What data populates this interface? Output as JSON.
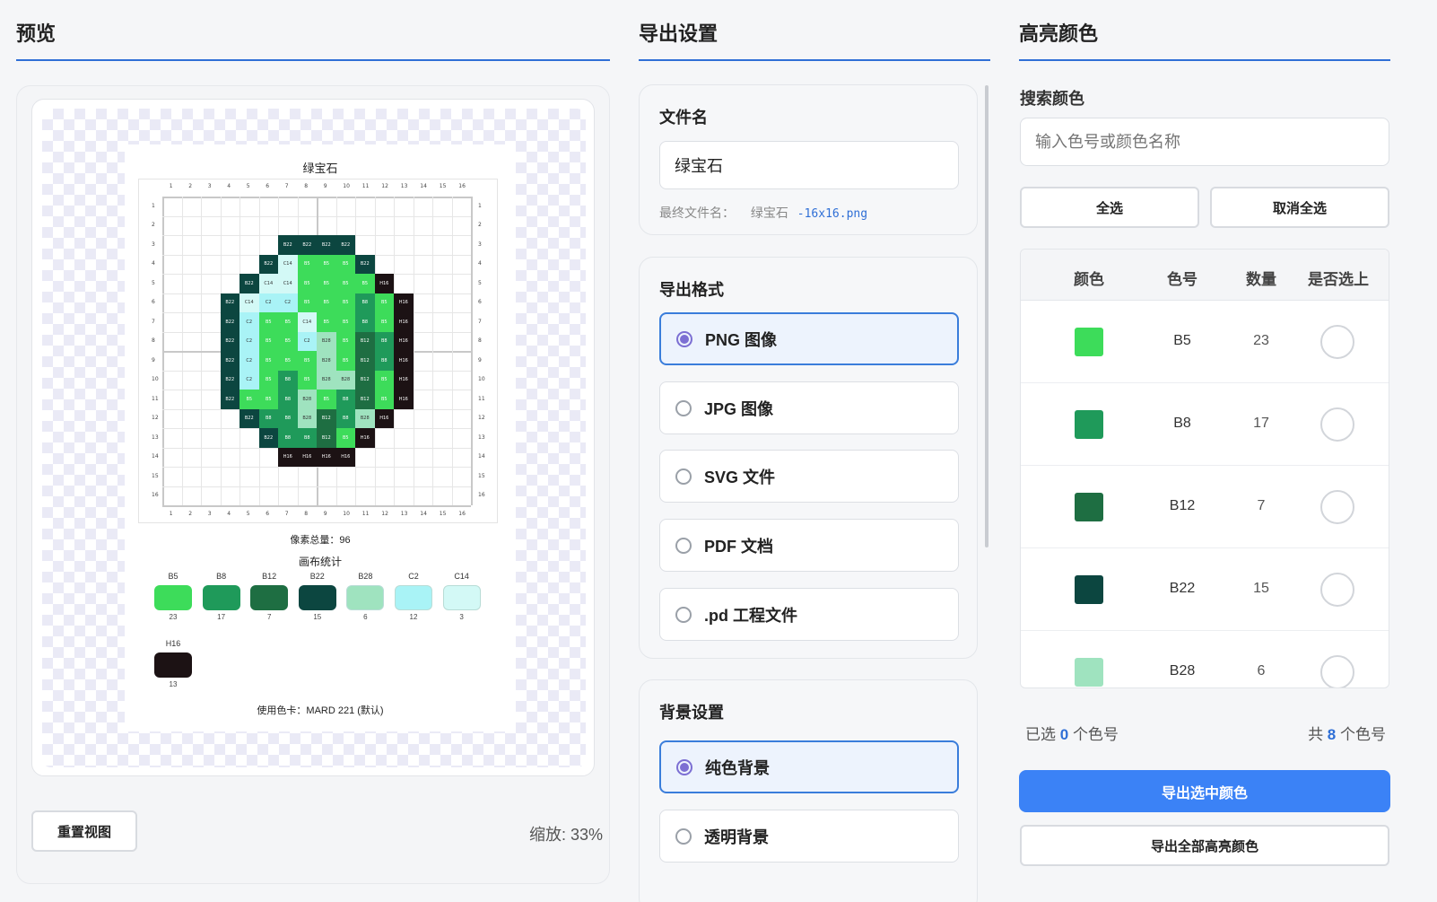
{
  "preview": {
    "title": "预览",
    "sheet_title": "绿宝石",
    "axis_numbers": [
      "1",
      "2",
      "3",
      "4",
      "5",
      "6",
      "7",
      "8",
      "9",
      "10",
      "11",
      "12",
      "13",
      "14",
      "15",
      "16"
    ],
    "grid": [
      [
        "",
        "",
        "",
        "",
        "",
        "",
        "",
        "",
        "",
        "",
        "",
        "",
        "",
        "",
        "",
        ""
      ],
      [
        "",
        "",
        "",
        "",
        "",
        "",
        "",
        "",
        "",
        "",
        "",
        "",
        "",
        "",
        "",
        ""
      ],
      [
        "",
        "",
        "",
        "",
        "",
        "",
        "B22",
        "B22",
        "B22",
        "B22",
        "",
        "",
        "",
        "",
        "",
        ""
      ],
      [
        "",
        "",
        "",
        "",
        "",
        "B22",
        "C14",
        "B5",
        "B5",
        "B5",
        "B22",
        "",
        "",
        "",
        "",
        ""
      ],
      [
        "",
        "",
        "",
        "",
        "B22",
        "C14",
        "C14",
        "B5",
        "B5",
        "B5",
        "B5",
        "H16",
        "",
        "",
        "",
        ""
      ],
      [
        "",
        "",
        "",
        "B22",
        "C14",
        "C2",
        "C2",
        "B5",
        "B5",
        "B5",
        "B8",
        "B5",
        "H16",
        "",
        "",
        ""
      ],
      [
        "",
        "",
        "",
        "B22",
        "C2",
        "B5",
        "B5",
        "C14",
        "B5",
        "B5",
        "B8",
        "B5",
        "H16",
        "",
        "",
        ""
      ],
      [
        "",
        "",
        "",
        "B22",
        "C2",
        "B5",
        "B5",
        "C2",
        "B28",
        "B5",
        "B12",
        "B8",
        "H16",
        "",
        "",
        ""
      ],
      [
        "",
        "",
        "",
        "B22",
        "C2",
        "B5",
        "B5",
        "B5",
        "B28",
        "B5",
        "B12",
        "B8",
        "H16",
        "",
        "",
        ""
      ],
      [
        "",
        "",
        "",
        "B22",
        "C2",
        "B5",
        "B8",
        "B5",
        "B28",
        "B28",
        "B12",
        "B5",
        "H16",
        "",
        "",
        ""
      ],
      [
        "",
        "",
        "",
        "B22",
        "B5",
        "B5",
        "B8",
        "B28",
        "B5",
        "B8",
        "B12",
        "B5",
        "H16",
        "",
        "",
        ""
      ],
      [
        "",
        "",
        "",
        "",
        "B22",
        "B8",
        "B8",
        "B28",
        "B12",
        "B8",
        "B28",
        "H16",
        "",
        "",
        "",
        ""
      ],
      [
        "",
        "",
        "",
        "",
        "",
        "B22",
        "B8",
        "B8",
        "B12",
        "B5",
        "H16",
        "",
        "",
        "",
        "",
        ""
      ],
      [
        "",
        "",
        "",
        "",
        "",
        "",
        "H16",
        "H16",
        "H16",
        "H16",
        "",
        "",
        "",
        "",
        "",
        ""
      ],
      [
        "",
        "",
        "",
        "",
        "",
        "",
        "",
        "",
        "",
        "",
        "",
        "",
        "",
        "",
        "",
        ""
      ],
      [
        "",
        "",
        "",
        "",
        "",
        "",
        "",
        "",
        "",
        "",
        "",
        "",
        "",
        "",
        "",
        ""
      ]
    ],
    "total_label": "像素总量：96",
    "stats_title": "画布统计",
    "legend": [
      {
        "code": "B5",
        "count": "23",
        "color": "#3ddc5a"
      },
      {
        "code": "B8",
        "count": "17",
        "color": "#1f9a5a"
      },
      {
        "code": "B12",
        "count": "7",
        "color": "#1e6e42"
      },
      {
        "code": "B22",
        "count": "15",
        "color": "#0c4640"
      },
      {
        "code": "B28",
        "count": "6",
        "color": "#9fe3bf"
      },
      {
        "code": "C2",
        "count": "12",
        "color": "#a9f3f6"
      },
      {
        "code": "C14",
        "count": "3",
        "color": "#d3f9f6"
      },
      {
        "code": "H16",
        "count": "13",
        "color": "#1c1214"
      }
    ],
    "card_label": "使用色卡：MARD 221 (默认)",
    "reset_button": "重置视图",
    "zoom": "缩放: 33%"
  },
  "export": {
    "title": "导出设置",
    "filename_title": "文件名",
    "filename_value": "绿宝石",
    "final_label": "最终文件名：",
    "final_name": "绿宝石",
    "final_suffix": "-16x16.png",
    "format_title": "导出格式",
    "formats": [
      "PNG 图像",
      "JPG 图像",
      "SVG 文件",
      "PDF 文档",
      ".pd 工程文件"
    ],
    "selected_format": "PNG 图像",
    "background_title": "背景设置",
    "backgrounds": [
      "纯色背景",
      "透明背景"
    ],
    "selected_background": "纯色背景"
  },
  "highlight": {
    "title": "高亮颜色",
    "search_label": "搜索颜色",
    "search_placeholder": "输入色号或颜色名称",
    "select_all": "全选",
    "deselect_all": "取消全选",
    "columns": [
      "颜色",
      "色号",
      "数量",
      "是否选上"
    ],
    "rows": [
      {
        "code": "B5",
        "count": "23",
        "color": "#3ddc5a",
        "selected": false
      },
      {
        "code": "B8",
        "count": "17",
        "color": "#1f9a5a",
        "selected": false
      },
      {
        "code": "B12",
        "count": "7",
        "color": "#1e6e42",
        "selected": false
      },
      {
        "code": "B22",
        "count": "15",
        "color": "#0c4640",
        "selected": false
      },
      {
        "code": "B28",
        "count": "6",
        "color": "#9fe3bf",
        "selected": false
      }
    ],
    "selected_prefix": "已选",
    "selected_count": "0",
    "selected_suffix": "个色号",
    "total_prefix": "共",
    "total_count": "8",
    "total_suffix": "个色号",
    "export_selected": "导出选中颜色",
    "export_all": "导出全部高亮颜色"
  },
  "colors": {
    "accent": "#2f6fd6",
    "primary_button": "#3b82f6",
    "radio_selected": "#7c6fd3"
  }
}
